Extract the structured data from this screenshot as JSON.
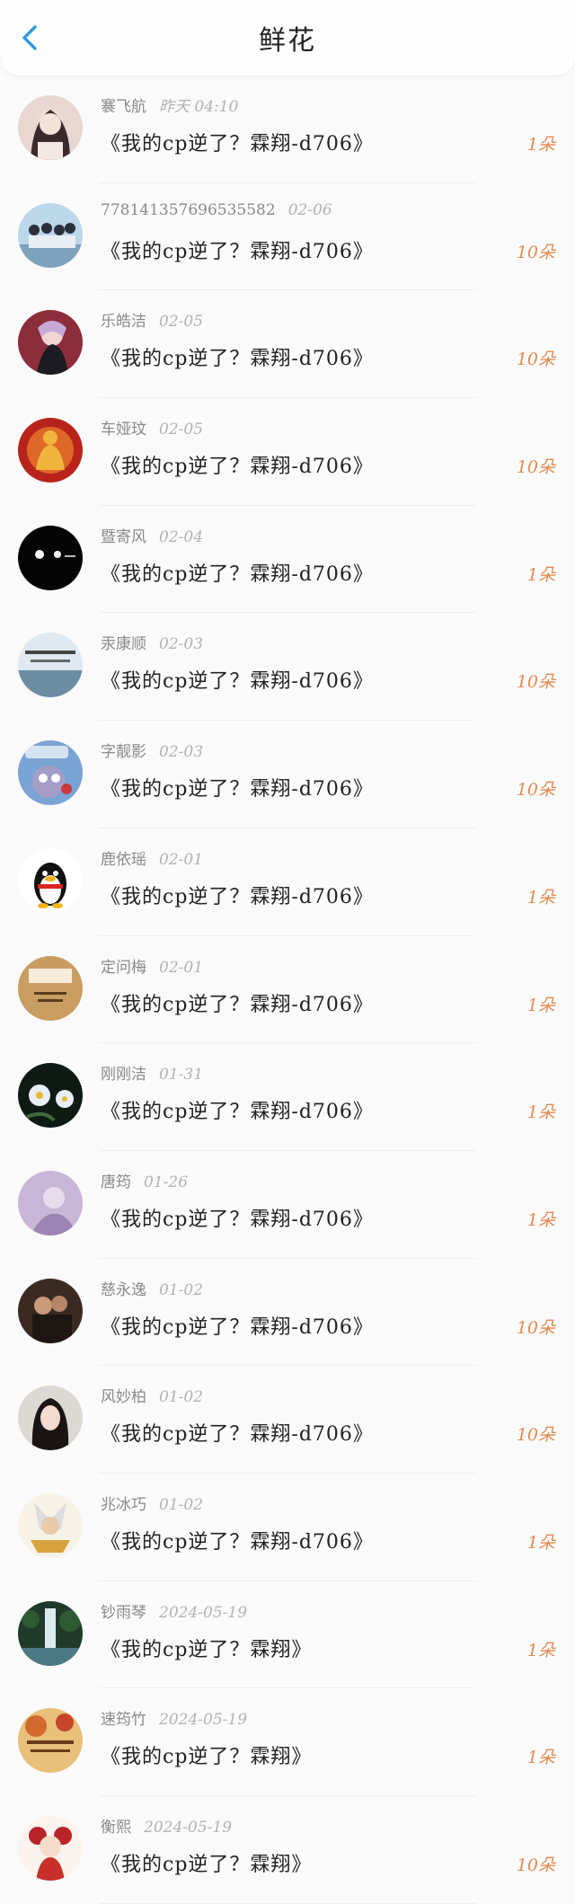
{
  "header": {
    "title": "鲜花",
    "back_icon": "chevron-left-icon",
    "accent_color": "#2f9be3"
  },
  "colors": {
    "count": "#e48a4f",
    "name": "#8a8a8a",
    "time": "#b3b3b3",
    "text": "#222222"
  },
  "items": [
    {
      "name": "褰飞航",
      "time": "昨天 04:10",
      "text": "《我的cp逆了？霖翔-d706》",
      "count": "1朵",
      "avatar": "avatar-girl-portrait"
    },
    {
      "name": "778141357696535582",
      "time": "02-06",
      "text": "《我的cp逆了？霖翔-d706》",
      "count": "10朵",
      "avatar": "avatar-group-photo"
    },
    {
      "name": "乐皓洁",
      "time": "02-05",
      "text": "《我的cp逆了？霖翔-d706》",
      "count": "10朵",
      "avatar": "avatar-anime-girl"
    },
    {
      "name": "车娅玟",
      "time": "02-05",
      "text": "《我的cp逆了？霖翔-d706》",
      "count": "10朵",
      "avatar": "avatar-golden-buddha"
    },
    {
      "name": "暨寄风",
      "time": "02-04",
      "text": "《我的cp逆了？霖翔-d706》",
      "count": "1朵",
      "avatar": "avatar-black-cats"
    },
    {
      "name": "汞康顺",
      "time": "02-03",
      "text": "《我的cp逆了？霖翔-d706》",
      "count": "10朵",
      "avatar": "avatar-sea-text"
    },
    {
      "name": "字靓影",
      "time": "02-03",
      "text": "《我的cp逆了？霖翔-d706》",
      "count": "10朵",
      "avatar": "avatar-cartoon-character"
    },
    {
      "name": "鹿依瑶",
      "time": "02-01",
      "text": "《我的cp逆了？霖翔-d706》",
      "count": "1朵",
      "avatar": "avatar-qq-penguin"
    },
    {
      "name": "定问梅",
      "time": "02-01",
      "text": "《我的cp逆了？霖翔-d706》",
      "count": "1朵",
      "avatar": "avatar-wood-graduation"
    },
    {
      "name": "刚刚洁",
      "time": "01-31",
      "text": "《我的cp逆了？霖翔-d706》",
      "count": "1朵",
      "avatar": "avatar-white-flowers"
    },
    {
      "name": "唐筠",
      "time": "01-26",
      "text": "《我的cp逆了？霖翔-d706》",
      "count": "1朵",
      "avatar": "avatar-purple-scene"
    },
    {
      "name": "慈永逸",
      "time": "01-02",
      "text": "《我的cp逆了？霖翔-d706》",
      "count": "10朵",
      "avatar": "avatar-couple-photo"
    },
    {
      "name": "风妙柏",
      "time": "01-02",
      "text": "《我的cp逆了？霖翔-d706》",
      "count": "10朵",
      "avatar": "avatar-dark-hair-girl"
    },
    {
      "name": "兆冰巧",
      "time": "01-02",
      "text": "《我的cp逆了？霖翔-d706》",
      "count": "1朵",
      "avatar": "avatar-armored-hero"
    },
    {
      "name": "钞雨琴",
      "time": "2024-05-19",
      "text": "《我的cp逆了？霖翔》",
      "count": "1朵",
      "avatar": "avatar-waterfall"
    },
    {
      "name": "速筠竹",
      "time": "2024-05-19",
      "text": "《我的cp逆了？霖翔》",
      "count": "1朵",
      "avatar": "avatar-autumn-text"
    },
    {
      "name": "衡熙",
      "time": "2024-05-19",
      "text": "《我的cp逆了？霖翔》",
      "count": "10朵",
      "avatar": "avatar-red-doll"
    }
  ]
}
